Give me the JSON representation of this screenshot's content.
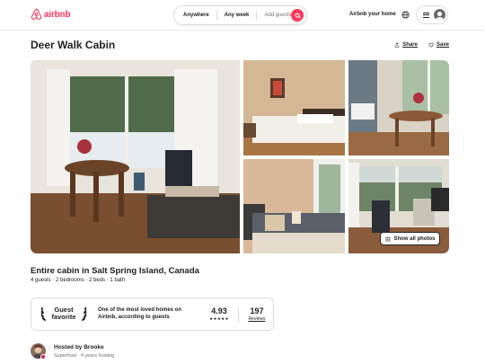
{
  "header": {
    "logo_text": "airbnb",
    "brand_color": "#ff385c",
    "search": {
      "location": "Anywhere",
      "dates": "Any week",
      "guests_placeholder": "Add guests"
    },
    "host_link": "Airbnb your home",
    "icons": [
      "airbnb-logo-icon",
      "search-icon",
      "globe-icon",
      "menu-icon",
      "user-avatar-icon"
    ]
  },
  "listing": {
    "title": "Deer Walk Cabin",
    "actions": {
      "share": "Share",
      "save": "Save"
    },
    "photos": {
      "show_all": "Show all photos"
    },
    "subtitle": "Entire cabin in Salt Spring Island, Canada",
    "details": "4 guests · 2 bedrooms · 2 beds · 1 bath"
  },
  "guest_favorite": {
    "title_line1": "Guest",
    "title_line2": "favorite",
    "description": "One of the most loved homes on Airbnb, according to guests",
    "rating": "4.93",
    "stars": "★★★★★",
    "reviews_count": "197",
    "reviews_label": "Reviews"
  },
  "host": {
    "name": "Hosted by Brooke",
    "meta": "Superhost · 4 years hosting"
  }
}
